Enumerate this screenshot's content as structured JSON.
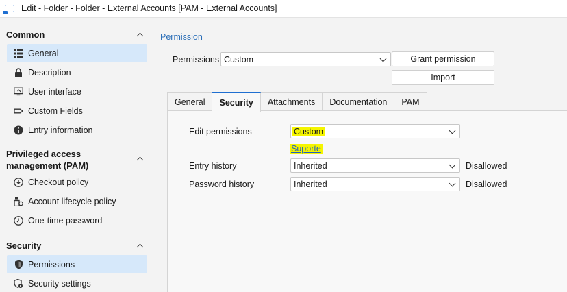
{
  "window": {
    "title": "Edit - Folder - Folder - External Accounts [PAM - External Accounts]"
  },
  "sidebar": {
    "sections": [
      {
        "header": "Common",
        "items": [
          {
            "label": "General",
            "icon": "list-icon",
            "selected": true
          },
          {
            "label": "Description",
            "icon": "lock-icon",
            "selected": false
          },
          {
            "label": "User interface",
            "icon": "monitor-icon",
            "selected": false
          },
          {
            "label": "Custom Fields",
            "icon": "tag-icon",
            "selected": false
          },
          {
            "label": "Entry information",
            "icon": "info-icon",
            "selected": false
          }
        ]
      },
      {
        "header": "Privileged access management (PAM)",
        "items": [
          {
            "label": "Checkout policy",
            "icon": "download-circle-icon",
            "selected": false
          },
          {
            "label": "Account lifecycle policy",
            "icon": "lifecycle-icon",
            "selected": false
          },
          {
            "label": "One-time password",
            "icon": "clock-icon",
            "selected": false
          }
        ]
      },
      {
        "header": "Security",
        "items": [
          {
            "label": "Permissions",
            "icon": "shield-icon",
            "selected": true
          },
          {
            "label": "Security settings",
            "icon": "shield-gear-icon",
            "selected": false
          }
        ]
      }
    ]
  },
  "content": {
    "group_label": "Permission",
    "permissions": {
      "label": "Permissions",
      "value": "Custom"
    },
    "buttons": {
      "grant": "Grant permission",
      "import": "Import"
    },
    "tabs": [
      {
        "label": "General",
        "active": false
      },
      {
        "label": "Security",
        "active": true
      },
      {
        "label": "Attachments",
        "active": false
      },
      {
        "label": "Documentation",
        "active": false
      },
      {
        "label": "PAM",
        "active": false
      }
    ],
    "security": {
      "edit_permissions": {
        "label": "Edit permissions",
        "value": "Custom",
        "link": "Suporte"
      },
      "entry_history": {
        "label": "Entry history",
        "value": "Inherited",
        "status": "Disallowed"
      },
      "password_history": {
        "label": "Password history",
        "value": "Inherited",
        "status": "Disallowed"
      }
    }
  },
  "colors": {
    "accent": "#1f6fd1",
    "selection": "#d6e8fa",
    "highlight": "#f5f500",
    "group_label": "#2c6fb8"
  }
}
